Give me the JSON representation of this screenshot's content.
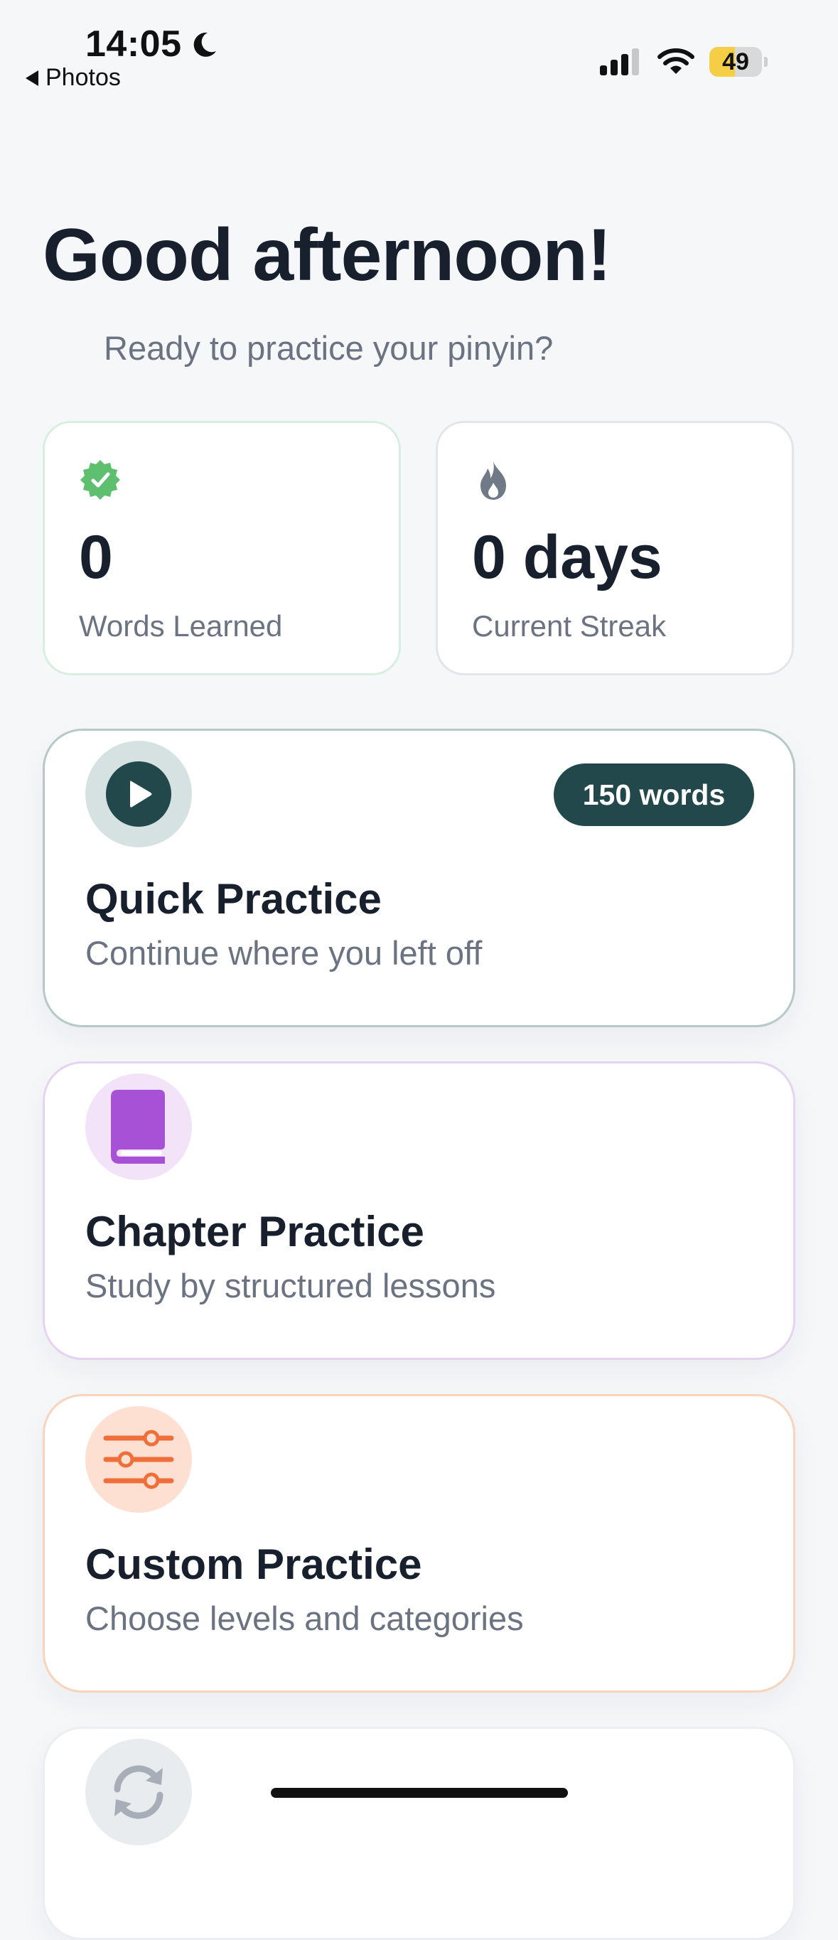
{
  "status_bar": {
    "time": "14:05",
    "back_label": "Photos",
    "battery_level": "49",
    "battery_fraction": 0.49
  },
  "greeting": {
    "title": "Good afternoon!",
    "subtitle": "Ready to practice your pinyin?"
  },
  "stats": {
    "words_learned": {
      "value": "0",
      "label": "Words Learned",
      "icon": "check-badge-icon"
    },
    "streak": {
      "value": "0 days",
      "label": "Current Streak",
      "icon": "flame-icon"
    }
  },
  "cards": {
    "quick": {
      "title": "Quick Practice",
      "subtitle": "Continue where you left off",
      "badge": "150 words",
      "icon": "play-icon"
    },
    "chapter": {
      "title": "Chapter Practice",
      "subtitle": "Study by structured lessons",
      "icon": "book-icon"
    },
    "custom": {
      "title": "Custom Practice",
      "subtitle": "Choose levels and categories",
      "icon": "sliders-icon"
    },
    "review": {
      "icon": "refresh-icon"
    }
  },
  "colors": {
    "accent_dark_teal": "#22484b",
    "green": "#5ec06f",
    "purple": "#a651d6",
    "orange": "#ef6e3a",
    "text_primary": "#18202e",
    "text_secondary": "#6b7382"
  }
}
